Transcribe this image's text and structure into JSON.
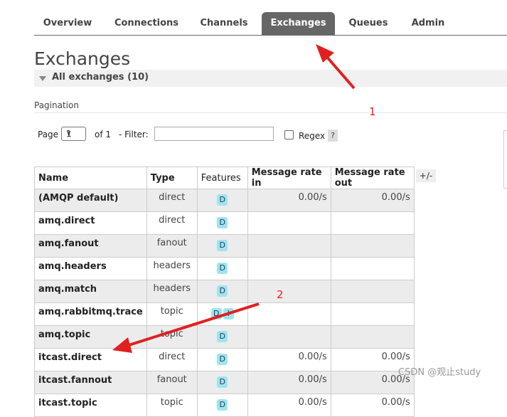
{
  "nav": {
    "tabs": [
      {
        "label": "Overview"
      },
      {
        "label": "Connections"
      },
      {
        "label": "Channels"
      },
      {
        "label": "Exchanges",
        "active": true
      },
      {
        "label": "Queues"
      },
      {
        "label": "Admin"
      }
    ]
  },
  "page_title": "Exchanges",
  "section_label": "All exchanges (10)",
  "pagination": {
    "label": "Pagination",
    "page_label": "Page",
    "page_value": "1",
    "of_text": "of 1",
    "filter_label": "- Filter:",
    "filter_value": "",
    "regex_label": "Regex",
    "help_label": "?"
  },
  "table": {
    "headers": [
      "Name",
      "Type",
      "Features",
      "Message rate in",
      "Message rate out"
    ],
    "toggle_label": "+/-",
    "rows": [
      {
        "name": "(AMQP default)",
        "type": "direct",
        "features": [
          "D"
        ],
        "rate_in": "0.00/s",
        "rate_out": "0.00/s"
      },
      {
        "name": "amq.direct",
        "type": "direct",
        "features": [
          "D"
        ],
        "rate_in": "",
        "rate_out": ""
      },
      {
        "name": "amq.fanout",
        "type": "fanout",
        "features": [
          "D"
        ],
        "rate_in": "",
        "rate_out": ""
      },
      {
        "name": "amq.headers",
        "type": "headers",
        "features": [
          "D"
        ],
        "rate_in": "",
        "rate_out": ""
      },
      {
        "name": "amq.match",
        "type": "headers",
        "features": [
          "D"
        ],
        "rate_in": "",
        "rate_out": ""
      },
      {
        "name": "amq.rabbitmq.trace",
        "type": "topic",
        "features": [
          "D",
          "I"
        ],
        "rate_in": "",
        "rate_out": ""
      },
      {
        "name": "amq.topic",
        "type": "topic",
        "features": [
          "D"
        ],
        "rate_in": "",
        "rate_out": ""
      },
      {
        "name": "itcast.direct",
        "type": "direct",
        "features": [
          "D"
        ],
        "rate_in": "0.00/s",
        "rate_out": "0.00/s"
      },
      {
        "name": "itcast.fannout",
        "type": "fanout",
        "features": [
          "D"
        ],
        "rate_in": "0.00/s",
        "rate_out": "0.00/s"
      },
      {
        "name": "itcast.topic",
        "type": "topic",
        "features": [
          "D"
        ],
        "rate_in": "0.00/s",
        "rate_out": "0.00/s"
      }
    ]
  },
  "annotations": {
    "label_1": "1",
    "label_2": "2",
    "color": "#e02020"
  },
  "watermark": "CSDN @观止study",
  "colors": {
    "active_tab": "#666666",
    "badge": "#9ee5ee",
    "stripe": "#ececec"
  }
}
